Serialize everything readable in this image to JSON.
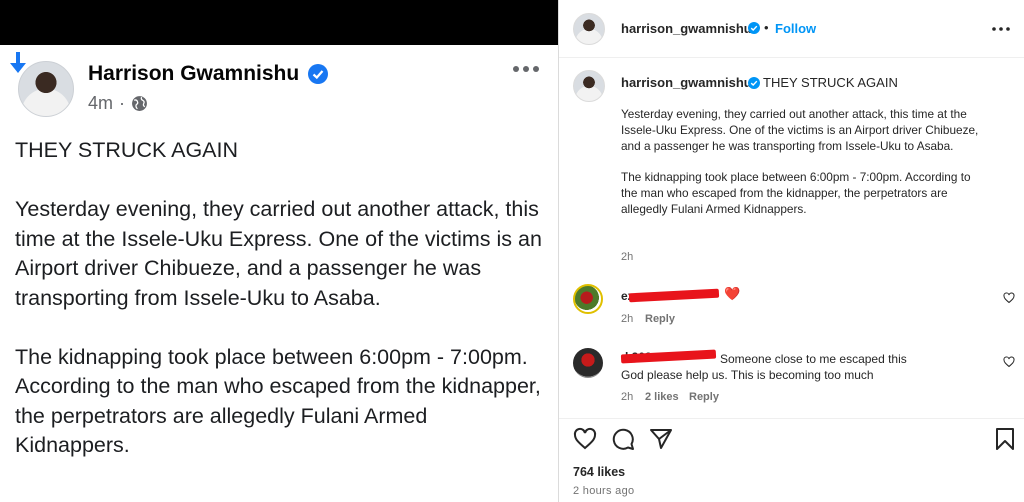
{
  "facebook": {
    "author": "Harrison Gwamnishu",
    "timestamp": "4m",
    "separator": "·",
    "title": "THEY STRUCK AGAIN",
    "paragraph1": "Yesterday evening, they carried out another attack, this time at the Issele-Uku Express. One of the victims is an Airport driver Chibueze, and a passenger he was transporting from Issele-Uku to Asaba.",
    "paragraph2": "The kidnapping took place between 6:00pm - 7:00pm. According to the man who escaped from the kidnapper, the perpetrators are allegedly Fulani Armed Kidnappers."
  },
  "instagram": {
    "username": "harrison_gwamnishu",
    "dot": "•",
    "follow_label": "Follow",
    "caption_title": "THEY STRUCK AGAIN",
    "caption_p1": "Yesterday evening, they carried out another attack, this time at the Issele-Uku Express. One of the victims is an Airport driver Chibueze, and a passenger he was transporting from Issele-Uku to Asaba.",
    "caption_p2": "The kidnapping took place between 6:00pm - 7:00pm. According to the man who escaped from the kidnapper, the perpetrators are allegedly Fulani Armed Kidnappers.",
    "caption_time": "2h",
    "comments": [
      {
        "username": "ez",
        "emoji": "❤️",
        "time": "2h",
        "reply_label": "Reply"
      },
      {
        "username": "d 203",
        "text_line1": "Someone close to me escaped this",
        "text_line2": "God please help us. This is becoming too much",
        "time": "2h",
        "likes": "2 likes",
        "reply_label": "Reply"
      }
    ],
    "likes_count": "764 likes",
    "time_ago": "2 hours ago",
    "colors": {
      "follow": "#0095f6",
      "verified": "#0095f6",
      "redaction": "#e8141b"
    }
  }
}
